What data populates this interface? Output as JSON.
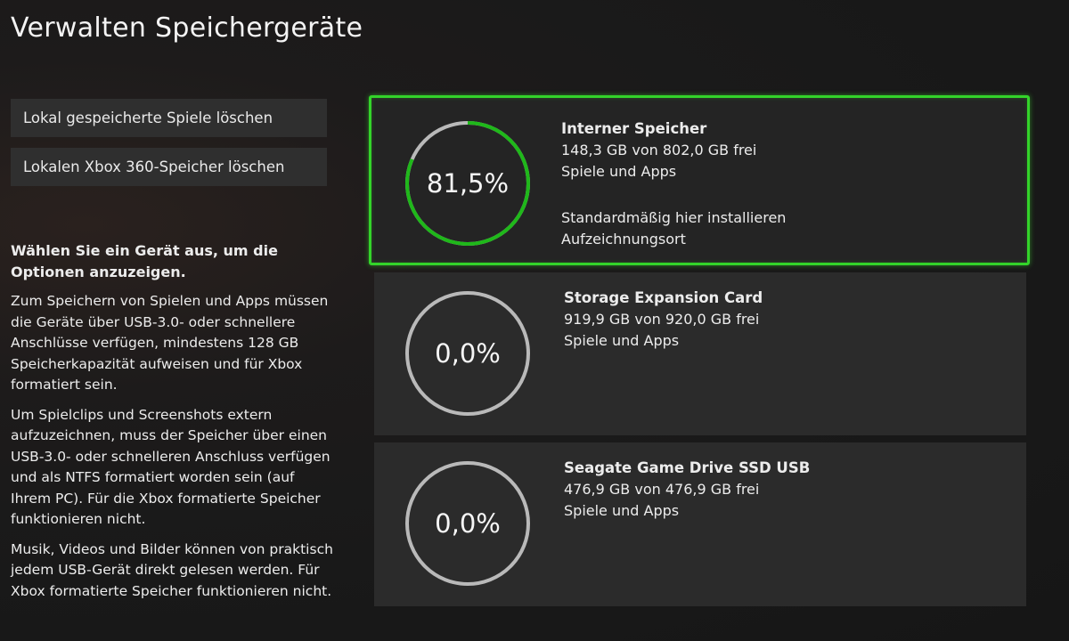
{
  "page": {
    "title": "Verwalten Speichergeräte"
  },
  "actions": [
    {
      "label": "Lokal gespeicherte Spiele löschen"
    },
    {
      "label": "Lokalen Xbox 360-Speicher löschen"
    }
  ],
  "info": {
    "heading": "Wählen Sie ein Gerät aus, um die Optionen anzuzeigen.",
    "paragraphs": [
      "Zum Speichern von Spielen und Apps müssen die Geräte über USB-3.0- oder schnellere Anschlüsse verfügen, mindestens 128 GB Speicherkapazität aufweisen und für Xbox formatiert sein.",
      "Um Spielclips und Screenshots extern aufzuzeichnen, muss der Speicher über einen USB-3.0- oder schnelleren Anschluss verfügen und als NTFS formatiert worden sein (auf Ihrem PC). Für die Xbox formatierte Speicher funktionieren nicht.",
      "Musik, Videos und Bilder können von praktisch jedem USB-Gerät direkt gelesen werden. Für Xbox formatierte Speicher funktionieren nicht."
    ]
  },
  "devices": [
    {
      "name": "Interner Speicher",
      "usage_label": "81,5%",
      "usage_fraction": 0.815,
      "free": "148,3 GB von 802,0 GB frei",
      "type": "Spiele und Apps",
      "default_install": "Standardmäßig hier installieren",
      "capture_location": "Aufzeichnungsort",
      "selected": true
    },
    {
      "name": "Storage Expansion Card",
      "usage_label": "0,0%",
      "usage_fraction": 0.0,
      "free": "919,9 GB von 920,0 GB frei",
      "type": "Spiele und Apps",
      "selected": false
    },
    {
      "name": "Seagate Game Drive SSD USB",
      "usage_label": "0,0%",
      "usage_fraction": 0.0,
      "free": "476,9 GB von 476,9 GB frei",
      "type": "Spiele und Apps",
      "selected": false
    }
  ],
  "colors": {
    "accent": "#33d42a",
    "ring_used": "#1fb81a",
    "ring_track": "#b9b9b9",
    "card_bg": "#2b2b2b",
    "page_bg": "#1b1b1b"
  }
}
